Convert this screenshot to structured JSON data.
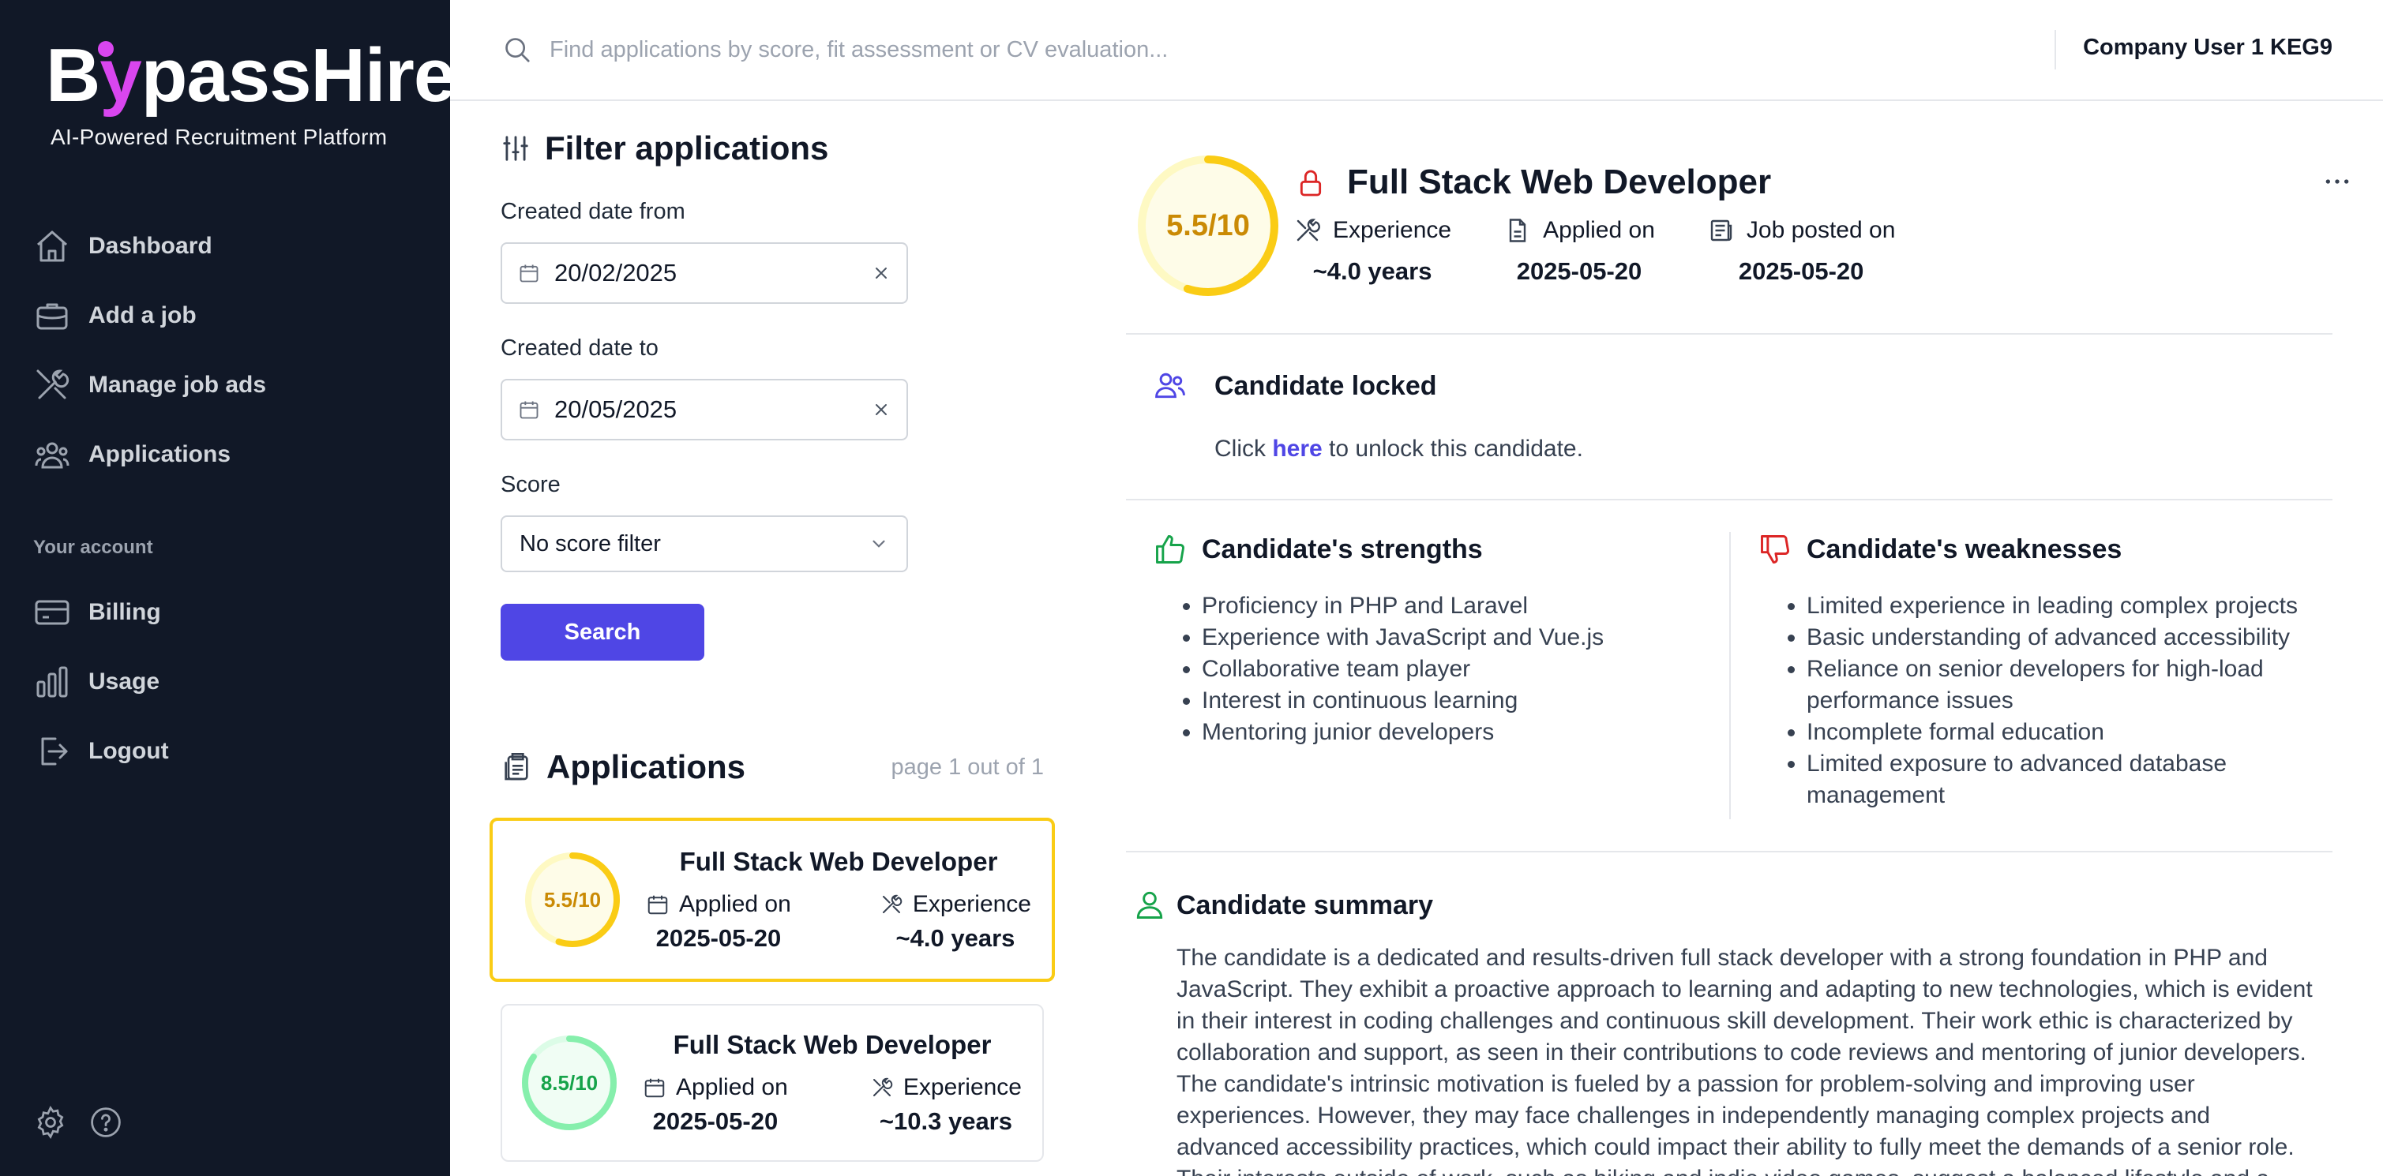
{
  "brand": {
    "name_a": "B",
    "name_b": "passHire",
    "tagline": "AI-Powered Recruitment Platform"
  },
  "sidebar": {
    "items": [
      {
        "label": "Dashboard",
        "icon": "home-icon"
      },
      {
        "label": "Add a job",
        "icon": "briefcase-icon"
      },
      {
        "label": "Manage job ads",
        "icon": "tools-icon"
      },
      {
        "label": "Applications",
        "icon": "users-icon"
      }
    ],
    "section_label": "Your account",
    "account_items": [
      {
        "label": "Billing",
        "icon": "credit-card-icon"
      },
      {
        "label": "Usage",
        "icon": "bar-chart-icon"
      },
      {
        "label": "Logout",
        "icon": "logout-icon"
      }
    ]
  },
  "topbar": {
    "search_placeholder": "Find applications by score, fit assessment or CV evaluation...",
    "user": "Company User 1 KEG9"
  },
  "filter": {
    "title": "Filter applications",
    "from_label": "Created date from",
    "from_value": "20/02/2025",
    "to_label": "Created date to",
    "to_value": "20/05/2025",
    "score_label": "Score",
    "score_value": "No score filter",
    "search_label": "Search"
  },
  "applications": {
    "title": "Applications",
    "page_info": "page 1 out of 1",
    "items": [
      {
        "score_text": "5.5/10",
        "score": 5.5,
        "color": "#facc15",
        "text_color": "#ca8a04",
        "title": "Full Stack Web Developer",
        "applied_label": "Applied on",
        "applied": "2025-05-20",
        "exp_label": "Experience",
        "exp": "~4.0 years",
        "selected": true
      },
      {
        "score_text": "8.5/10",
        "score": 8.5,
        "color": "#86efac",
        "text_color": "#16a34a",
        "title": "Full Stack Web Developer",
        "applied_label": "Applied on",
        "applied": "2025-05-20",
        "exp_label": "Experience",
        "exp": "~10.3 years",
        "selected": false
      }
    ]
  },
  "detail": {
    "score_text": "5.5/10",
    "score": 5.5,
    "title": "Full Stack Web Developer",
    "experience_label": "Experience",
    "experience": "~4.0 years",
    "applied_label": "Applied on",
    "applied": "2025-05-20",
    "posted_label": "Job posted on",
    "posted": "2025-05-20",
    "locked_title": "Candidate locked",
    "locked_pre": "Click ",
    "locked_link": "here",
    "locked_post": " to unlock this candidate.",
    "strengths_title": "Candidate's strengths",
    "strengths": [
      "Proficiency in PHP and Laravel",
      "Experience with JavaScript and Vue.js",
      "Collaborative team player",
      "Interest in continuous learning",
      "Mentoring junior developers"
    ],
    "weaknesses_title": "Candidate's weaknesses",
    "weaknesses": [
      "Limited experience in leading complex projects",
      "Basic understanding of advanced accessibility",
      "Reliance on senior developers for high-load performance issues",
      "Incomplete formal education",
      "Limited exposure to advanced database management"
    ],
    "summary_title": "Candidate summary",
    "summary": "The candidate is a dedicated and results-driven full stack developer with a strong foundation in PHP and JavaScript. They exhibit a proactive approach to learning and adapting to new technologies, which is evident in their interest in coding challenges and continuous skill development. Their work ethic is characterized by collaboration and support, as seen in their contributions to code reviews and mentoring of junior developers. The candidate's intrinsic motivation is fueled by a passion for problem-solving and improving user experiences. However, they may face challenges in independently managing complex projects and advanced accessibility practices, which could impact their ability to fully meet the demands of a senior role. Their interests outside of work, such as biking and indie video games, suggest a balanced lifestyle and a creative"
  },
  "colors": {
    "sidebar_bg": "#111827",
    "accent": "#4f46e5",
    "brand_pink": "#d946ef",
    "score_mid": "#facc15",
    "score_high": "#86efac"
  }
}
